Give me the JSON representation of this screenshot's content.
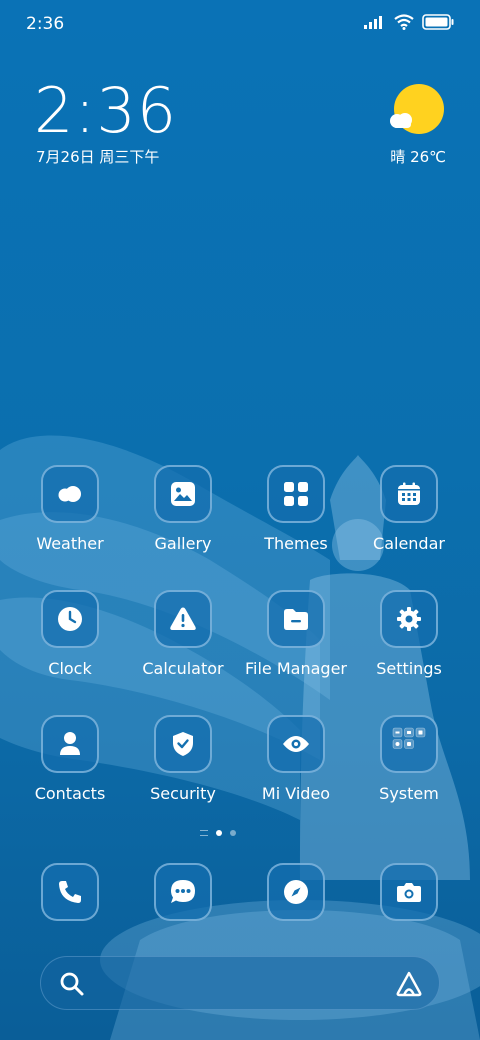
{
  "status_bar": {
    "time": "2:36",
    "icons": [
      "signal-icon",
      "wifi-icon",
      "battery-icon"
    ]
  },
  "clock_widget": {
    "time": "2:36",
    "date": "7月26日 周三下午"
  },
  "weather_widget": {
    "condition": "晴",
    "temperature": "26℃",
    "icon": "sun-cloud-icon"
  },
  "apps": [
    {
      "label": "Weather",
      "icon": "cloud-icon"
    },
    {
      "label": "Gallery",
      "icon": "image-icon"
    },
    {
      "label": "Themes",
      "icon": "grid-icon"
    },
    {
      "label": "Calendar",
      "icon": "calendar-icon"
    },
    {
      "label": "Clock",
      "icon": "clock-icon"
    },
    {
      "label": "Calculator",
      "icon": "warning-icon"
    },
    {
      "label": "File Manager",
      "icon": "folder-icon"
    },
    {
      "label": "Settings",
      "icon": "gear-icon"
    },
    {
      "label": "Contacts",
      "icon": "person-icon"
    },
    {
      "label": "Security",
      "icon": "shield-icon"
    },
    {
      "label": "Mi Video",
      "icon": "eye-icon"
    },
    {
      "label": "System",
      "icon": "folder-grid-icon"
    }
  ],
  "page_indicator": {
    "pages": 2,
    "active": 1
  },
  "dock": [
    {
      "icon": "phone-icon"
    },
    {
      "icon": "message-icon"
    },
    {
      "icon": "compass-icon"
    },
    {
      "icon": "camera-icon"
    }
  ],
  "search": {
    "icon": "search-icon",
    "assistant_icon": "assistant-icon"
  },
  "colors": {
    "accent": "#ffd21f",
    "background": "#0a6fae"
  }
}
